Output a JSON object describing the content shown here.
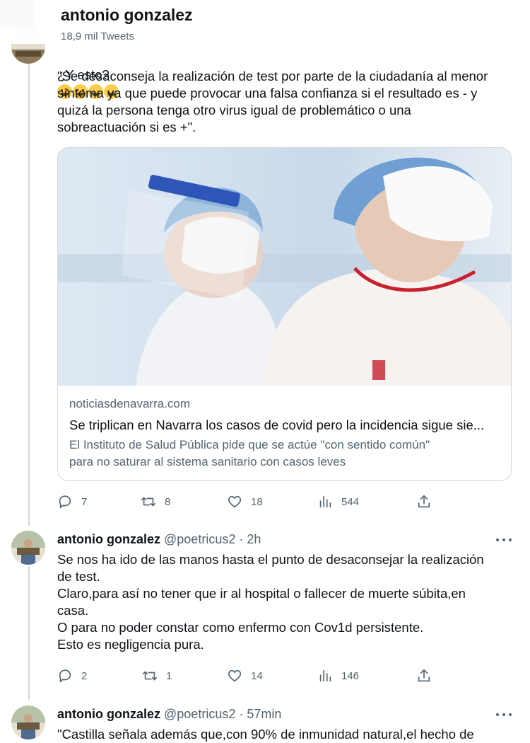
{
  "header": {
    "title": "antonio gonzalez",
    "subtitle": "18,9 mil Tweets"
  },
  "tweet1": {
    "first_line": "¿Y esto?",
    "emojis": [
      "sweat-smile",
      "sweat-smile",
      "loudly-crying",
      "loudly-crying"
    ],
    "body": "\"Se desaconseja la realización de test por parte de la ciudadanía al menor\nsíntoma ya que puede provocar una falsa confianza si el resultado es - y\nquizá la persona tenga otro virus igual de problemático o una\nsobreactuación si es +\".",
    "card": {
      "domain": "noticiasdenavarra.com",
      "title": "Se triplican en Navarra los casos de covid pero la incidencia sigue sie...",
      "description": "El Instituto de Salud Pública pide que se actúe \"con sentido común\"\npara no saturar al sistema sanitario con casos leves",
      "image_alt": "Sanitarios con mascarilla y pantalla protectora"
    },
    "stats": {
      "replies": "7",
      "retweets": "8",
      "likes": "18",
      "views": "544"
    }
  },
  "tweet2": {
    "name": "antonio gonzalez",
    "handle": "@poetricus2 · 2h",
    "body": "Se nos ha ido de las manos hasta el punto de desaconsejar la realización\nde test.\nClaro,para así no tener que ir al hospital o fallecer de muerte súbita,en\ncasa.\nO para no poder constar como enfermo con Cov1d persistente.\nEsto es negligencia pura.",
    "stats": {
      "replies": "2",
      "retweets": "1",
      "likes": "14",
      "views": "146"
    }
  },
  "tweet3": {
    "name": "antonio gonzalez",
    "handle": "@poetricus2 · 57min",
    "body": "\"Castilla señala además que,con 90% de inmunidad natural,el hecho de"
  },
  "icons": {
    "reply": "reply-icon",
    "retweet": "retweet-icon",
    "like": "heart-icon",
    "views": "views-icon",
    "share": "share-icon",
    "more": "more-icon"
  },
  "colors": {
    "text": "#0f1419",
    "secondary": "#536471",
    "border": "#cfd9de"
  }
}
